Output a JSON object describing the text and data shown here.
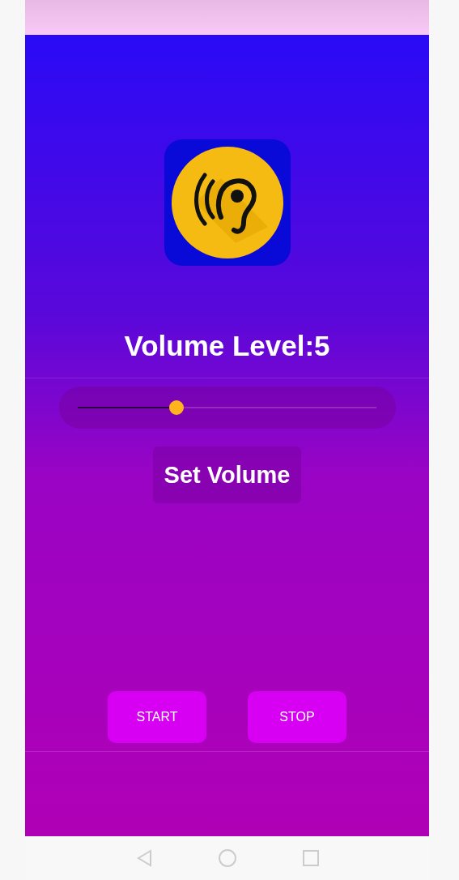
{
  "title": "Volume Level:5",
  "slider": {
    "level": 0.33
  },
  "set_button": "Set Volume",
  "buttons": [
    "START",
    "STOP"
  ]
}
